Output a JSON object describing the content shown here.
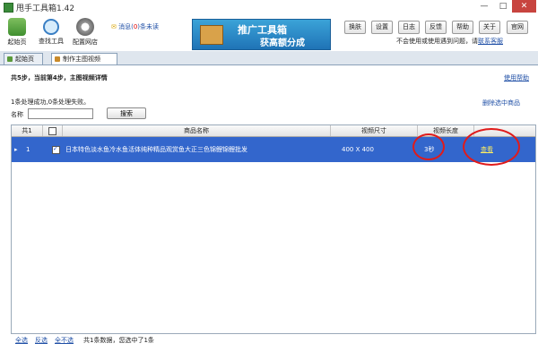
{
  "window": {
    "title": "甩手工具箱1.42",
    "controls": [
      "—",
      "□",
      "✕"
    ]
  },
  "toolbar": {
    "items": [
      {
        "label": "起始页",
        "icon": "home-icon"
      },
      {
        "label": "查找工具",
        "icon": "search-icon"
      },
      {
        "label": "配置网店",
        "icon": "gear-icon"
      }
    ],
    "message_prefix": "消息(",
    "message_count": "0",
    "message_suffix": ")条未读",
    "banner_line1": "推广工具箱",
    "banner_line2": "获高额分成",
    "right_buttons": [
      "换肤",
      "设置",
      "日志",
      "反馈",
      "帮助",
      "关于",
      "官网"
    ],
    "notice_text": "不会使用或使用遇到问题，请",
    "notice_link": "联系客服"
  },
  "tabs": [
    {
      "label": "起始页",
      "active": false
    },
    {
      "label": "制作主图视频",
      "active": true
    }
  ],
  "page": {
    "step_text": "共5步，当前第4步，主图视频详情",
    "help_link": "使用帮助",
    "result_text": "1条处理成功,0条处理失败。",
    "delete_link": "删除选中商品",
    "name_label": "名称",
    "name_value": "",
    "search_button": "搜索"
  },
  "table": {
    "headers": [
      "共1",
      "",
      "商品名称",
      "视频尺寸",
      "视频长度",
      ""
    ],
    "rows": [
      {
        "index": "1",
        "checked": true,
        "name": "日本特色淡水鱼冷水鱼活体纯种精品观赏鱼大正三色锦鲤锦鲤批发",
        "size": "400 X 400",
        "length": "3秒",
        "action": "查看"
      }
    ]
  },
  "footer": {
    "select_all": "全选",
    "invert": "反选",
    "select_none": "全不选",
    "summary": "共1条数据，您选中了1条"
  },
  "colors": {
    "selection": "#3366cc",
    "annotation": "#e01b1b",
    "link": "#1f4fa6",
    "close": "#c8443f"
  }
}
